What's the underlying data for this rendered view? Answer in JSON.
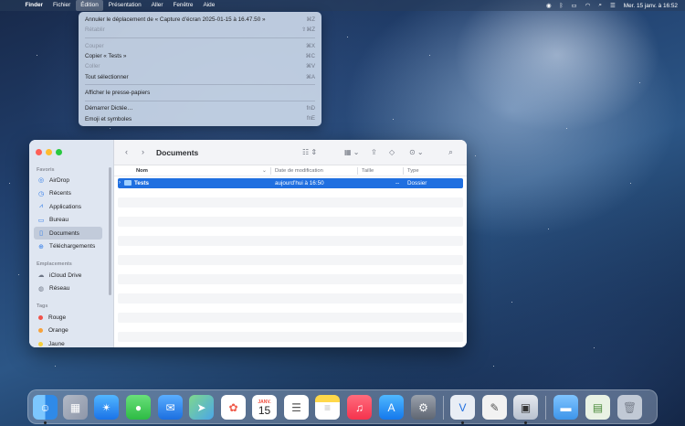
{
  "menubar": {
    "app": "Finder",
    "items": [
      "Fichier",
      "Édition",
      "Présentation",
      "Aller",
      "Fenêtre",
      "Aide"
    ],
    "clock": "Mer. 15 janv. à 16:52"
  },
  "edit_menu": {
    "undo": {
      "label": "Annuler le déplacement de « Capture d’écran 2025-01-15 à 16.47.50 »",
      "shortcut": "⌘Z"
    },
    "redo": {
      "label": "Rétablir",
      "shortcut": "⇧⌘Z"
    },
    "cut": {
      "label": "Couper",
      "shortcut": "⌘X"
    },
    "copy": {
      "label": "Copier « Tests »",
      "shortcut": "⌘C"
    },
    "paste": {
      "label": "Coller",
      "shortcut": "⌘V"
    },
    "select_all": {
      "label": "Tout sélectionner",
      "shortcut": "⌘A"
    },
    "clipboard": {
      "label": "Afficher le presse-papiers"
    },
    "dictation": {
      "label": "Démarrer Dictée…",
      "shortcut": "fnD"
    },
    "emoji": {
      "label": "Emoji et symboles",
      "shortcut": "fnE"
    }
  },
  "finder": {
    "title": "Documents",
    "sidebar": {
      "favoris_title": "Favoris",
      "favoris": [
        "AirDrop",
        "Récents",
        "Applications",
        "Bureau",
        "Documents",
        "Téléchargements"
      ],
      "emplacements_title": "Emplacements",
      "emplacements": [
        "iCloud Drive",
        "Réseau"
      ],
      "tags_title": "Tags",
      "tags": [
        {
          "label": "Rouge",
          "color": "#f0524a"
        },
        {
          "label": "Orange",
          "color": "#f7a23b"
        },
        {
          "label": "Jaune",
          "color": "#f5cf3a"
        }
      ]
    },
    "columns": {
      "name": "Nom",
      "date": "Date de modification",
      "size": "Taille",
      "type": "Type"
    },
    "rows": [
      {
        "name": "Tests",
        "date": "aujourd’hui à 16:50",
        "size": "--",
        "type": "Dossier"
      }
    ]
  },
  "dock": {
    "calendar_month": "JANV.",
    "calendar_day": "15"
  },
  "colors": {
    "selection": "#1f6fe0",
    "accent": "#2f7be9"
  }
}
